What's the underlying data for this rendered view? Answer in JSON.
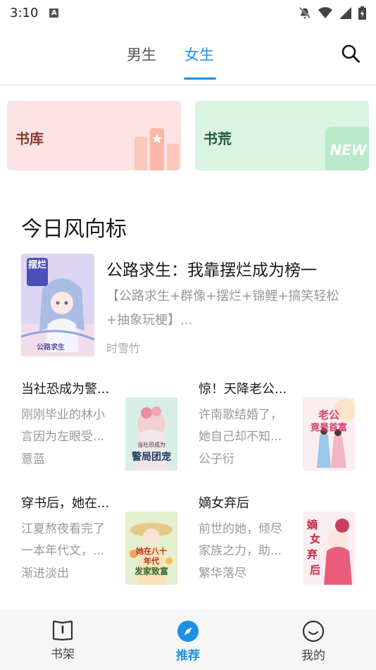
{
  "status_bar": {
    "time": "3:10",
    "notif_badge": "A"
  },
  "top_tabs": [
    {
      "label": "男生",
      "active": false
    },
    {
      "label": "女生",
      "active": true
    }
  ],
  "accent_color": "#1e90e6",
  "search_icon": "search-icon",
  "cards": [
    {
      "label": "书库",
      "icon": "book-stack-star-icon",
      "color": "#fde3e3"
    },
    {
      "label": "书荒",
      "badge": "NEW",
      "color": "#d9f4e1"
    }
  ],
  "section_title": "今日风向标",
  "featured": {
    "title": "公路求生：我靠摆烂成为榜一",
    "description": "【公路求生+群像+摆烂+锦鲤+搞笑轻松+抽象玩梗】...",
    "author": "时雪竹",
    "cover": {
      "title_text": "摆烂",
      "subtitle": "公路求生"
    }
  },
  "books": [
    {
      "title": "当社恐成为警...",
      "description": "刚刚毕业的林小言因为左眼受...",
      "author": "薏蓝",
      "cover": {
        "lines": [
          "当社恐成为",
          "警局团宠"
        ]
      }
    },
    {
      "title": "惊！天降老公...",
      "description": "许南歌结婚了，她自己却不知...",
      "author": "公子衍",
      "cover": {
        "lines": [
          "老公",
          "竟是首富"
        ]
      }
    },
    {
      "title": "穿书后，她在...",
      "description": "江夏熬夜看完了一本年代文，...",
      "author": "渐进淡出",
      "cover": {
        "lines": [
          "她在八十",
          "年代",
          "发家致富"
        ]
      }
    },
    {
      "title": "嫡女弃后",
      "description": "前世的她，倾尽家族之力，助...",
      "author": "繁华落尽",
      "cover": {
        "lines": [
          "嫡",
          "女",
          "弃",
          "后"
        ]
      }
    }
  ],
  "bottom_nav": [
    {
      "label": "书架",
      "icon": "bookshelf-icon",
      "active": false
    },
    {
      "label": "推荐",
      "icon": "compass-icon",
      "active": true
    },
    {
      "label": "我的",
      "icon": "smiley-icon",
      "active": false
    }
  ]
}
